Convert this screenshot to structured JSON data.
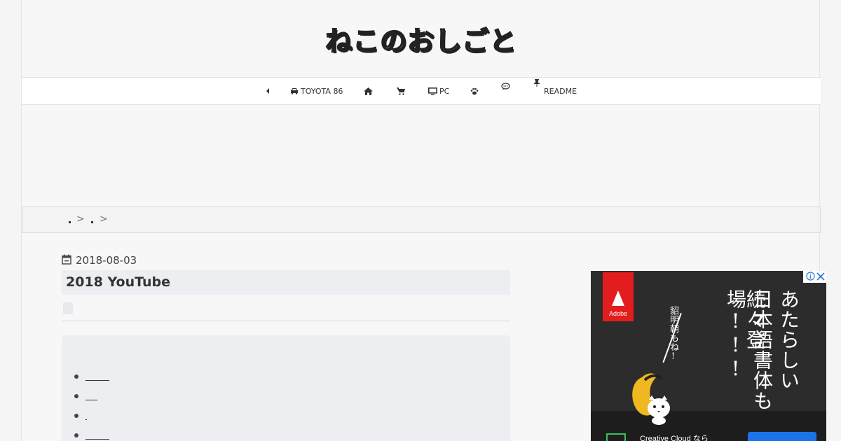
{
  "site": {
    "title": "ねこのおしごと"
  },
  "nav": {
    "items": [
      {
        "id": "back",
        "icon": "caret-left-icon",
        "label": ""
      },
      {
        "id": "toyota",
        "icon": "car-icon",
        "label": "TOYOTA 86"
      },
      {
        "id": "home",
        "icon": "home-icon",
        "label": ""
      },
      {
        "id": "shop",
        "icon": "cart-icon",
        "label": ""
      },
      {
        "id": "pc",
        "icon": "desktop-icon",
        "label": "PC"
      },
      {
        "id": "pets",
        "icon": "paw-icon",
        "label": ""
      },
      {
        "id": "comments",
        "icon": "comment-icon",
        "label": ""
      },
      {
        "id": "readme",
        "icon": "pin-icon",
        "label": "README"
      }
    ]
  },
  "breadcrumb": {
    "sep1": ">",
    "sep2": ">"
  },
  "article": {
    "date": "2018-08-03",
    "title": "2018 YouTube",
    "toc_count": 4
  },
  "side_ad": {
    "brand": "Adobe",
    "headline_col1": "あたらしい",
    "headline_col2": "日本語書体も",
    "headline_col3": "続々登場!!!",
    "sub": "貂明朝もね!",
    "bottom_text": "Creative Cloud なら"
  },
  "colors": {
    "ad_red": "#e31d1d",
    "cta_blue": "#1c73e8",
    "panel_grey": "#eceef1"
  }
}
